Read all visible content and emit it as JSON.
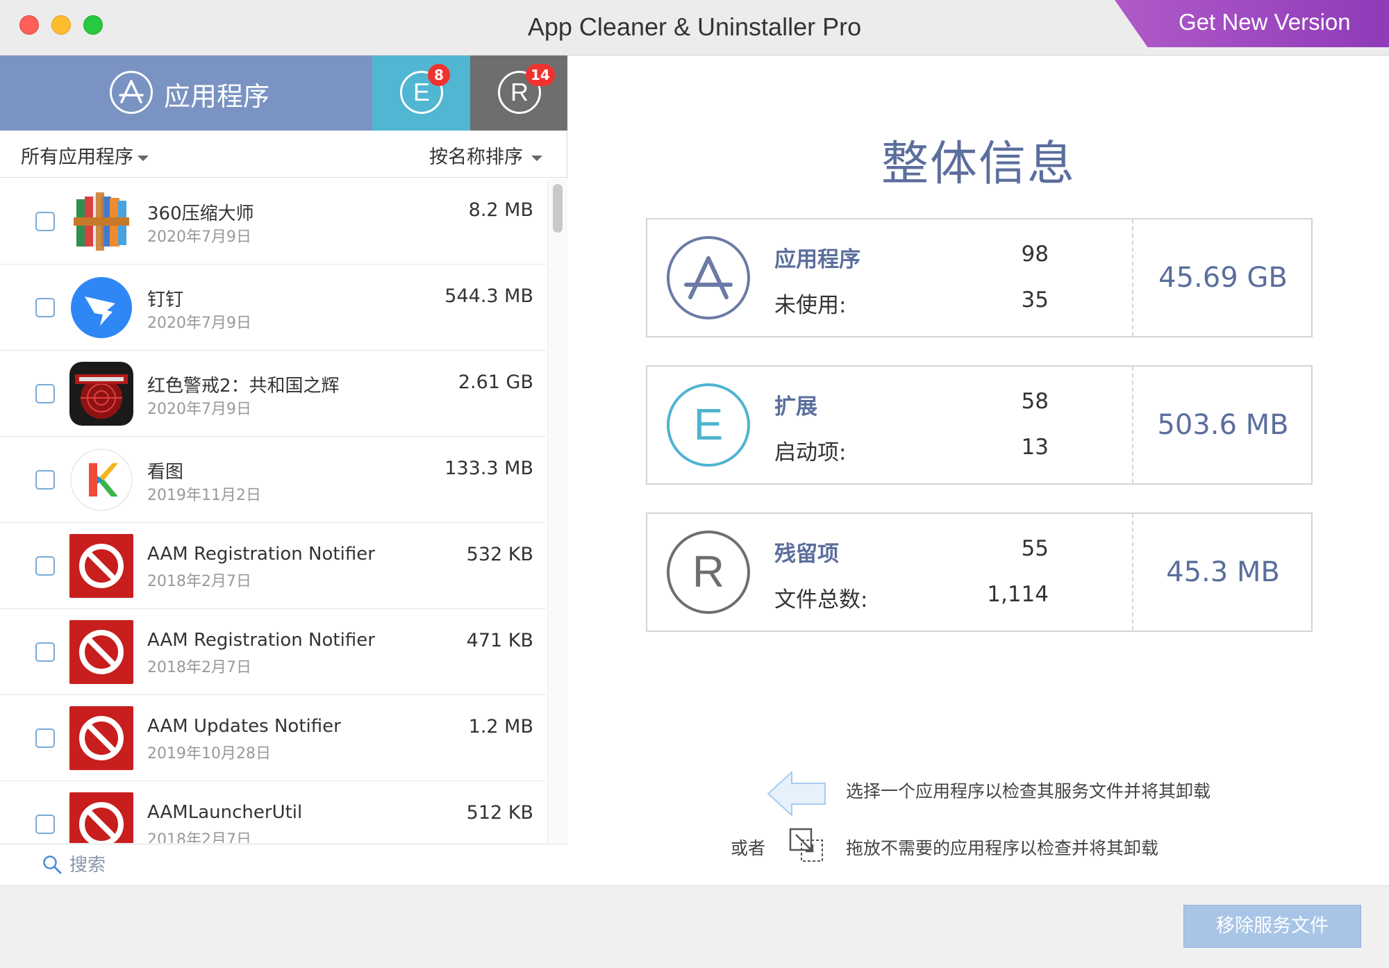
{
  "window": {
    "title": "App Cleaner & Uninstaller Pro",
    "promo_label": "Get New Version"
  },
  "tabs": {
    "apps": {
      "label": "应用程序",
      "icon": "app-store-icon"
    },
    "extensions": {
      "icon_letter": "E",
      "badge": "8"
    },
    "remains": {
      "icon_letter": "R",
      "badge": "14"
    }
  },
  "filters": {
    "scope": "所有应用程序",
    "sort": "按名称排序"
  },
  "apps": [
    {
      "name": "360压缩大师",
      "date": "2020年7月9日",
      "size": "8.2 MB",
      "icon": "archive-books-icon"
    },
    {
      "name": "钉钉",
      "date": "2020年7月9日",
      "size": "544.3 MB",
      "icon": "dingtalk-icon"
    },
    {
      "name": "红色警戒2：共和国之辉",
      "date": "2020年7月9日",
      "size": "2.61 GB",
      "icon": "red-alert-icon"
    },
    {
      "name": "看图",
      "date": "2019年11月2日",
      "size": "133.3 MB",
      "icon": "kantu-icon"
    },
    {
      "name": "AAM Registration Notifier",
      "date": "2018年2月7日",
      "size": "532 KB",
      "icon": "adobe-prohibited-icon"
    },
    {
      "name": "AAM Registration Notifier",
      "date": "2018年2月7日",
      "size": "471 KB",
      "icon": "adobe-prohibited-icon"
    },
    {
      "name": "AAM Updates Notifier",
      "date": "2019年10月28日",
      "size": "1.2 MB",
      "icon": "adobe-prohibited-icon"
    },
    {
      "name": "AAMLauncherUtil",
      "date": "2018年2月7日",
      "size": "512 KB",
      "icon": "adobe-prohibited-icon"
    }
  ],
  "search": {
    "placeholder": "搜索"
  },
  "overview": {
    "title": "整体信息",
    "cards": [
      {
        "label1": "应用程序",
        "value1": "98",
        "label2": "未使用:",
        "value2": "35",
        "total": "45.69 GB",
        "icon_letter": "A",
        "color": "#6b7aa6"
      },
      {
        "label1": "扩展",
        "value1": "58",
        "label2": "启动项:",
        "value2": "13",
        "total": "503.6 MB",
        "icon_letter": "E",
        "color": "#4fb3d0"
      },
      {
        "label1": "残留项",
        "value1": "55",
        "label2": "文件总数:",
        "value2": "1,114",
        "total": "45.3 MB",
        "icon_letter": "R",
        "color": "#6e6e6e"
      }
    ]
  },
  "hints": {
    "select": "选择一个应用程序以检查其服务文件并将其卸载",
    "or": "或者",
    "drag": "拖放不需要的应用程序以检查并将其卸载"
  },
  "footer": {
    "remove_label": "移除服务文件"
  },
  "colors": {
    "apps_tab": "#7a93c2",
    "ext_tab": "#50b6d1",
    "remains_tab": "#6e6e6e",
    "accent_text": "#5b6e9c",
    "remove_button": "#a8c4e6"
  }
}
